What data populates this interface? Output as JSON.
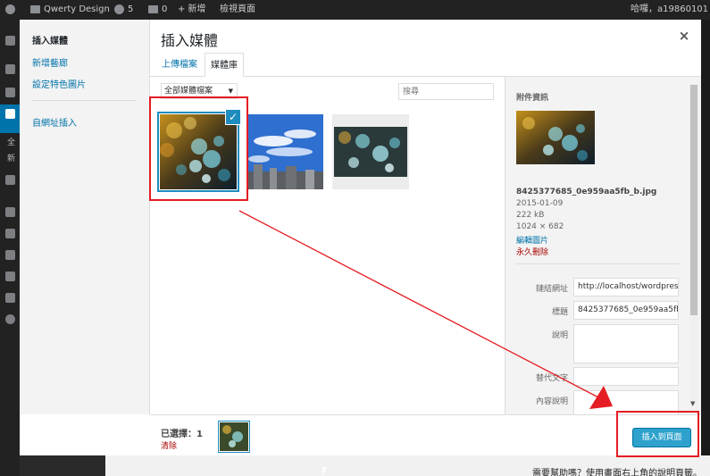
{
  "admin_bar": {
    "site_name": "Qwerty Design",
    "updates_count": "5",
    "comments_count": "0",
    "new_label": "新增",
    "view_page_label": "檢視頁面",
    "greeting": "哈囉，a19860101"
  },
  "admin_menu_cut": {
    "text_1": "全",
    "text_2": "新"
  },
  "media_frame": {
    "title": "插入媒體",
    "menu": {
      "items": [
        {
          "label": "插入媒體"
        },
        {
          "label": "新增藝廊"
        },
        {
          "label": "設定特色圖片"
        },
        {
          "label": "自網址插入"
        }
      ]
    },
    "tabs": [
      {
        "label": "上傳檔案"
      },
      {
        "label": "媒體庫"
      }
    ],
    "filter": {
      "selected": "全部媒體檔案"
    },
    "search": {
      "placeholder": "搜尋"
    },
    "attachment_details": {
      "header": "附件資訊",
      "filename": "8425377685_0e959aa5fb_b.jpg",
      "date": "2015-01-09",
      "filesize": "222 kB",
      "dimensions": "1024 × 682",
      "edit_link": "編輯圖片",
      "delete_link": "永久刪除",
      "fields": {
        "url_label": "鏈結網址",
        "url_value": "http://localhost/wordpres",
        "title_label": "標題",
        "title_value": "8425377685_0e959aa5fb_",
        "caption_label": "說明",
        "alt_label": "替代文字",
        "description_label": "內容說明"
      }
    },
    "toolbar": {
      "selected_count": "已選擇：1",
      "clear_label": "清除",
      "insert_button": "插入到頁面"
    }
  },
  "underlying_page": {
    "help_text": "需要幫助嗎？使用畫面右上角的說明頁籤。"
  },
  "colors": {
    "accent": "#0073aa",
    "button": "#2ea2cc",
    "annotation_red": "#e51c23"
  }
}
